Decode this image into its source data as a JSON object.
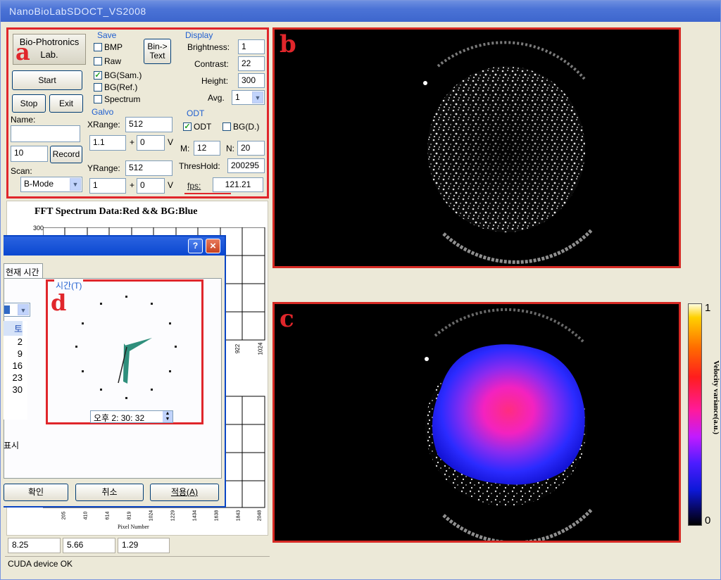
{
  "window": {
    "title": "NanoBioLabSDOCT_VS2008"
  },
  "markers": {
    "a": "a",
    "b": "b",
    "c": "c",
    "d": "d"
  },
  "control": {
    "logo_line1": "Bio-Photronics",
    "logo_line2": "Lab.",
    "start_label": "Start",
    "stop_label": "Stop",
    "exit_label": "Exit",
    "name_label": "Name:",
    "name_value": "",
    "count_value": "10",
    "record_label": "Record",
    "scan_label": "Scan:",
    "scan_value": "B-Mode",
    "save": {
      "group": "Save",
      "bmp": "BMP",
      "raw": "Raw",
      "bin_text_line1": "Bin->",
      "bin_text_line2": "Text",
      "bg_sam": "BG(Sam.)",
      "bg_ref": "BG(Ref.)",
      "spectrum": "Spectrum",
      "bg_sam_checked": true
    },
    "galvo": {
      "group": "Galvo",
      "xrange_label": "XRange:",
      "xrange_value": "512",
      "x_v1": "1.1",
      "x_v2": "0",
      "yrange_label": "YRange:",
      "yrange_value": "512",
      "y_v1": "1",
      "y_v2": "0",
      "plus": "+",
      "unit": "V"
    },
    "display": {
      "group": "Display",
      "brightness_label": "Brightness:",
      "brightness_value": "1",
      "contrast_label": "Contrast:",
      "contrast_value": "22",
      "height_label": "Height:",
      "height_value": "300",
      "avg_label": "Avg.",
      "avg_value": "1"
    },
    "odt": {
      "group": "ODT",
      "odt_label": "ODT",
      "odt_checked": true,
      "bgd_label": "BG(D.)",
      "m_label": "M:",
      "m_value": "12",
      "n_label": "N:",
      "n_value": "20",
      "threshold_label": "ThresHold:",
      "threshold_value": "200295",
      "fps_label": "fps:",
      "fps_value": "121.21"
    }
  },
  "fft_chart": {
    "title": "FFT Spectrum Data:Red && BG:Blue",
    "y_top": "300",
    "x_ticks_upper": [
      "922",
      "1024"
    ],
    "x_ticks_lower": [
      "205",
      "410",
      "614",
      "819",
      "1024",
      "1229",
      "1434",
      "1638",
      "1843",
      "2048"
    ],
    "x_label": "Pixel Number"
  },
  "dialog": {
    "tab_label": "현재 시간",
    "time_group": "시간(T)",
    "time_value": "오후  2: 30: 32",
    "list_items": [
      "토",
      "2",
      "9",
      "16",
      "23",
      "30"
    ],
    "option_label": "표시",
    "ok": "확인",
    "cancel": "취소",
    "apply": "적용(A)",
    "help": "?",
    "close": "×"
  },
  "colorbar": {
    "max_label": "1",
    "min_label": "0",
    "axis_title": "Velocity variance(a.u.)"
  },
  "status": {
    "v1": "8.25",
    "v2": "5.66",
    "v3": "1.29",
    "message": "CUDA device OK"
  },
  "colors": {
    "highlight_red": "#e0262b",
    "title_bar_blue": "#4b73d6",
    "group_label_blue": "#1f5fd0"
  }
}
